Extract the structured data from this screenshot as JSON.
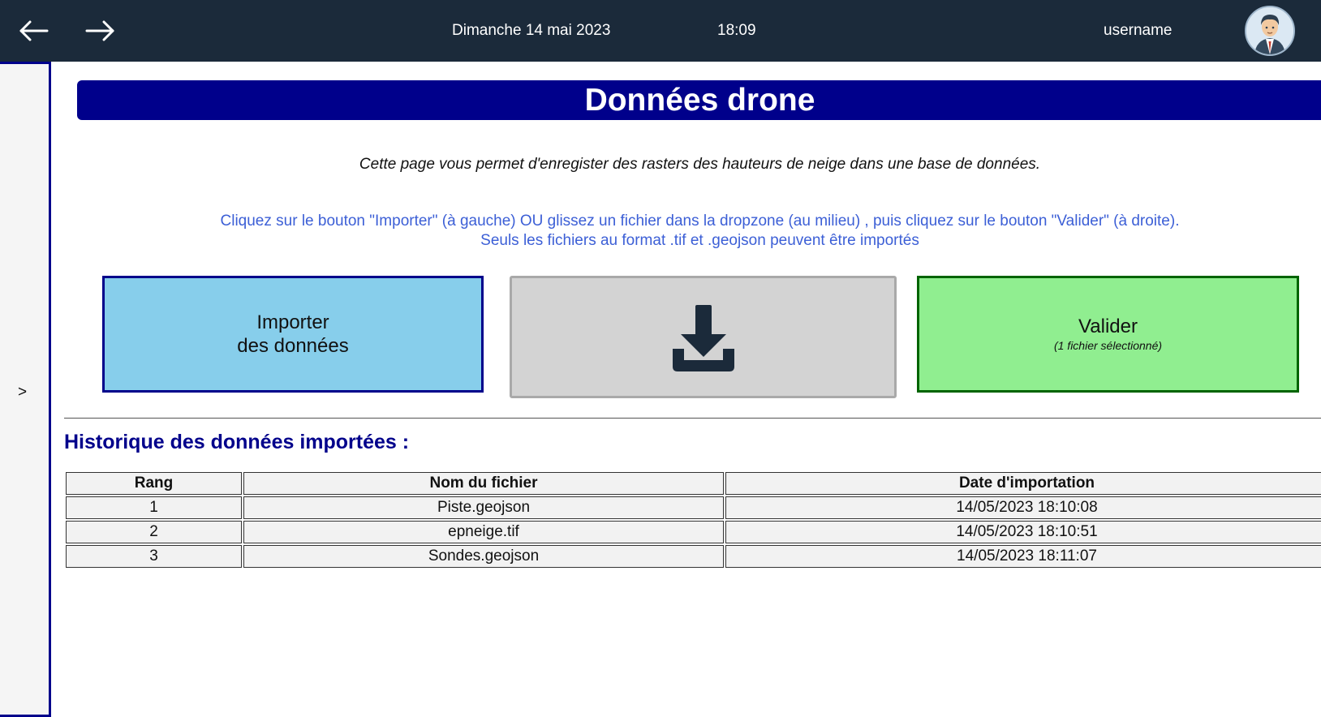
{
  "header": {
    "back_icon": "arrow-left-icon",
    "forward_icon": "arrow-right-icon",
    "date": "Dimanche 14 mai 2023",
    "time": "18:09",
    "username": "username",
    "avatar_icon": "user-avatar-icon",
    "background": "#1b2a3a"
  },
  "sidebar": {
    "toggle_label": ">"
  },
  "page": {
    "title": "Données drone",
    "title_color": "#00008b",
    "intro": "Cette page vous permet d'enregister des rasters des hauteurs de neige dans une base de données.",
    "instructions_line1": "Cliquez sur le bouton \"Importer\" (à gauche) OU glissez un fichier dans la dropzone (au milieu) , puis cliquez sur le bouton \"Valider\" (à droite).",
    "instructions_line2": "Seuls les fichiers au format .tif et .geojson peuvent être importés"
  },
  "actions": {
    "import_line1": "Importer",
    "import_line2": "des données",
    "dropzone_icon": "download-icon",
    "validate_label": "Valider",
    "validate_sub": "(1 fichier sélectionné)"
  },
  "history": {
    "title": "Historique des données importées :",
    "columns": [
      "Rang",
      "Nom du fichier",
      "Date d'importation"
    ],
    "rows": [
      [
        "1",
        "Piste.geojson",
        "14/05/2023 18:10:08"
      ],
      [
        "2",
        "epneige.tif",
        "14/05/2023 18:10:51"
      ],
      [
        "3",
        "Sondes.geojson",
        "14/05/2023 18:11:07"
      ]
    ]
  }
}
